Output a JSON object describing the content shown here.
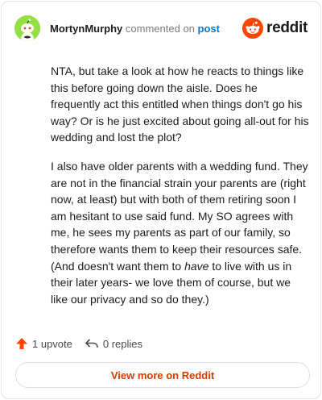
{
  "header": {
    "username": "MortynMurphy",
    "action_text": "commented on",
    "post_link": "post",
    "brand": "reddit"
  },
  "comment": {
    "paragraph_1": "NTA, but take a look at how he reacts to things like this before going down the aisle. Does he frequently act this entitled when things don't go his way? Or is he just excited about going all-out for his wedding and lost the plot?",
    "paragraph_2_before": "I also have older parents with a wedding fund. They are not in the financial strain your parents are (right now, at least) but with both of them retiring soon I am hesitant to use said fund. My SO agrees with me, he sees my parents as part of our family, so therefore wants them to keep their resources safe. (And doesn't want them to ",
    "paragraph_2_emphasis": "have",
    "paragraph_2_after": " to live with us in their later years- we love them of course, but we like our privacy and so do they.)"
  },
  "actions": {
    "upvotes": "1 upvote",
    "replies": "0 replies"
  },
  "footer": {
    "view_more": "View more on Reddit"
  },
  "colors": {
    "avatar_bg": "#94e044",
    "brand_orange": "#ff4500",
    "link_blue": "#0079d3",
    "view_more_text": "#d93a00"
  },
  "icons": {
    "avatar": "snoo-avatar-icon",
    "brand": "reddit-logo-icon",
    "upvote": "upvote-arrow-icon",
    "reply": "reply-arrow-icon"
  }
}
